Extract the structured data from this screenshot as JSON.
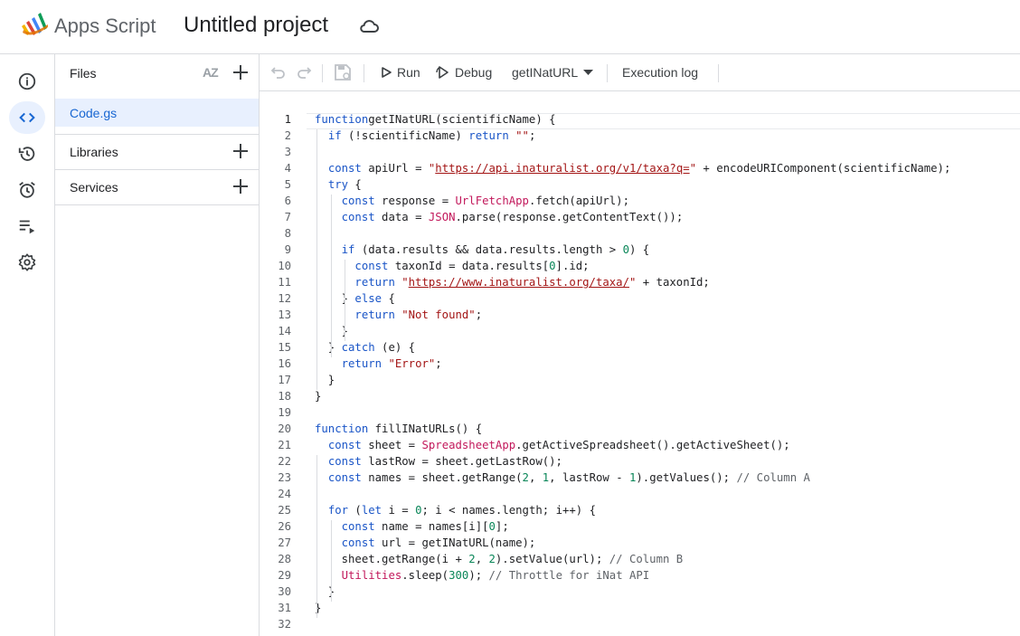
{
  "header": {
    "app_name": "Apps Script",
    "project_title": "Untitled project"
  },
  "files_panel": {
    "files_label": "Files",
    "sort_label": "AZ",
    "file_name": "Code.gs",
    "libraries_label": "Libraries",
    "services_label": "Services"
  },
  "toolbar": {
    "run_label": "Run",
    "debug_label": "Debug",
    "function_select": "getINatURL",
    "execution_log_label": "Execution log"
  },
  "editor": {
    "current_line": 1,
    "lines": [
      [
        [
          "kw",
          "function"
        ],
        [
          "",
          "getINatURL(scientificName) {"
        ]
      ],
      [
        [
          "",
          "  "
        ],
        [
          "kw",
          "if"
        ],
        [
          "",
          "",
          " (!scientificName) "
        ],
        [
          "kw",
          "return"
        ],
        [
          "",
          " "
        ],
        [
          "str",
          "\"\""
        ],
        [
          "",
          ";"
        ]
      ],
      [],
      [
        [
          "",
          "  "
        ],
        [
          "kw",
          "const"
        ],
        [
          "",
          " apiUrl = "
        ],
        [
          "str",
          "\""
        ],
        [
          "url",
          "https://api.inaturalist.org/v1/taxa?q="
        ],
        [
          "str",
          "\""
        ],
        [
          "",
          " + encodeURIComponent(scientificName);"
        ]
      ],
      [
        [
          "",
          "  "
        ],
        [
          "kw",
          "try"
        ],
        [
          "",
          " {"
        ]
      ],
      [
        [
          "",
          "    "
        ],
        [
          "kw",
          "const"
        ],
        [
          "",
          " response = "
        ],
        [
          "cls",
          "UrlFetchApp"
        ],
        [
          "",
          ".fetch(apiUrl);"
        ]
      ],
      [
        [
          "",
          "    "
        ],
        [
          "kw",
          "const"
        ],
        [
          "",
          " data = "
        ],
        [
          "cls",
          "JSON"
        ],
        [
          "",
          ".parse(response.getContentText());"
        ]
      ],
      [],
      [
        [
          "",
          "    "
        ],
        [
          "kw",
          "if"
        ],
        [
          "",
          " (data.results && data.results.length > "
        ],
        [
          "num",
          "0"
        ],
        [
          "",
          ") {"
        ]
      ],
      [
        [
          "",
          "      "
        ],
        [
          "kw",
          "const"
        ],
        [
          "",
          " taxonId = data.results["
        ],
        [
          "num",
          "0"
        ],
        [
          "",
          "].id;"
        ]
      ],
      [
        [
          "",
          "      "
        ],
        [
          "kw",
          "return"
        ],
        [
          "",
          " "
        ],
        [
          "str",
          "\""
        ],
        [
          "url",
          "https://www.inaturalist.org/taxa/"
        ],
        [
          "str",
          "\""
        ],
        [
          "",
          " + taxonId;"
        ]
      ],
      [
        [
          "",
          "    } "
        ],
        [
          "kw",
          "else"
        ],
        [
          "",
          " {"
        ]
      ],
      [
        [
          "",
          "      "
        ],
        [
          "kw",
          "return"
        ],
        [
          "",
          " "
        ],
        [
          "str",
          "\"Not found\""
        ],
        [
          "",
          ";"
        ]
      ],
      [
        [
          "",
          "    }"
        ]
      ],
      [
        [
          "",
          "  } "
        ],
        [
          "kw",
          "catch"
        ],
        [
          "",
          " (e) {"
        ]
      ],
      [
        [
          "",
          "    "
        ],
        [
          "kw",
          "return"
        ],
        [
          "",
          " "
        ],
        [
          "str",
          "\"Error\""
        ],
        [
          "",
          ";"
        ]
      ],
      [
        [
          "",
          "  }"
        ]
      ],
      [
        [
          "",
          "}"
        ]
      ],
      [],
      [
        [
          "kw",
          "function"
        ],
        [
          "",
          " fillINatURLs() {"
        ]
      ],
      [
        [
          "",
          "  "
        ],
        [
          "kw",
          "const"
        ],
        [
          "",
          " sheet = "
        ],
        [
          "cls",
          "SpreadsheetApp"
        ],
        [
          "",
          ".getActiveSpreadsheet().getActiveSheet();"
        ]
      ],
      [
        [
          "",
          "  "
        ],
        [
          "kw",
          "const"
        ],
        [
          "",
          " lastRow = sheet.getLastRow();"
        ]
      ],
      [
        [
          "",
          "  "
        ],
        [
          "kw",
          "const"
        ],
        [
          "",
          " names = sheet.getRange("
        ],
        [
          "num",
          "2"
        ],
        [
          "",
          ", "
        ],
        [
          "num",
          "1"
        ],
        [
          "",
          ", lastRow - "
        ],
        [
          "num",
          "1"
        ],
        [
          "",
          ").getValues(); "
        ],
        [
          "cmt",
          "// Column A"
        ]
      ],
      [],
      [
        [
          "",
          "  "
        ],
        [
          "kw",
          "for"
        ],
        [
          "",
          " ("
        ],
        [
          "kw",
          "let"
        ],
        [
          "",
          " i = "
        ],
        [
          "num",
          "0"
        ],
        [
          "",
          "; i < names.length; i++) {"
        ]
      ],
      [
        [
          "",
          "    "
        ],
        [
          "kw",
          "const"
        ],
        [
          "",
          " name = names[i]["
        ],
        [
          "num",
          "0"
        ],
        [
          "",
          "];"
        ]
      ],
      [
        [
          "",
          "    "
        ],
        [
          "kw",
          "const"
        ],
        [
          "",
          " url = getINatURL(name);"
        ]
      ],
      [
        [
          "",
          "    sheet.getRange(i + "
        ],
        [
          "num",
          "2"
        ],
        [
          "",
          ", "
        ],
        [
          "num",
          "2"
        ],
        [
          "",
          ").setValue(url); "
        ],
        [
          "cmt",
          "// Column B"
        ]
      ],
      [
        [
          "",
          "    "
        ],
        [
          "cls",
          "Utilities"
        ],
        [
          "",
          ".sleep("
        ],
        [
          "num",
          "300"
        ],
        [
          "",
          "); "
        ],
        [
          "cmt",
          "// Throttle for iNat API"
        ]
      ],
      [
        [
          "",
          "  }"
        ]
      ],
      [
        [
          "",
          "}"
        ]
      ],
      []
    ]
  }
}
